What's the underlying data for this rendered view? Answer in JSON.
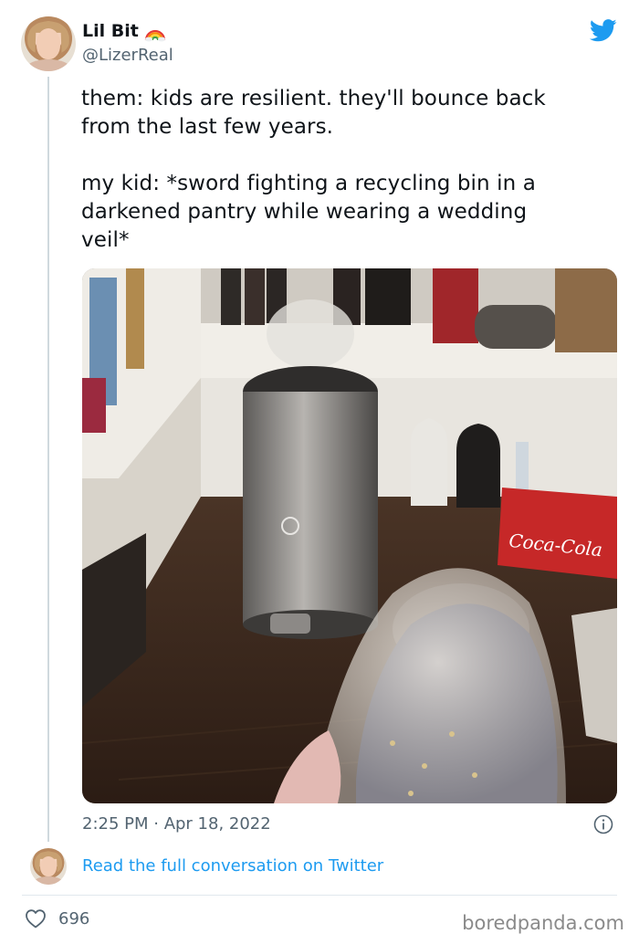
{
  "author": {
    "display_name": "Lil Bit",
    "handle": "@LizerReal",
    "name_emoji": "rainbow-icon",
    "avatar": "avatar"
  },
  "brand": {
    "logo": "twitter-bird-icon",
    "color": "#1d9bf0"
  },
  "tweet": {
    "paragraphs": [
      "them: kids are resilient. they'll bounce back\nfrom the last few years.",
      "my kid: *sword fighting a recycling bin in a\ndarkened pantry while wearing a wedding\nveil*"
    ],
    "image": "photo of a child wearing a wedding veil near a recycling bin in a dark pantry",
    "timestamp": "2:25 PM · Apr 18, 2022",
    "info_icon": "info-icon"
  },
  "conversation_link": "Read the full conversation on Twitter",
  "footer": {
    "like_icon": "heart-icon",
    "like_count": "696",
    "watermark": "boredpanda.com"
  },
  "colors": {
    "text": "#0f1419",
    "secondary": "#536471",
    "link": "#1d9bf0",
    "thread_line": "#cfd9de"
  }
}
